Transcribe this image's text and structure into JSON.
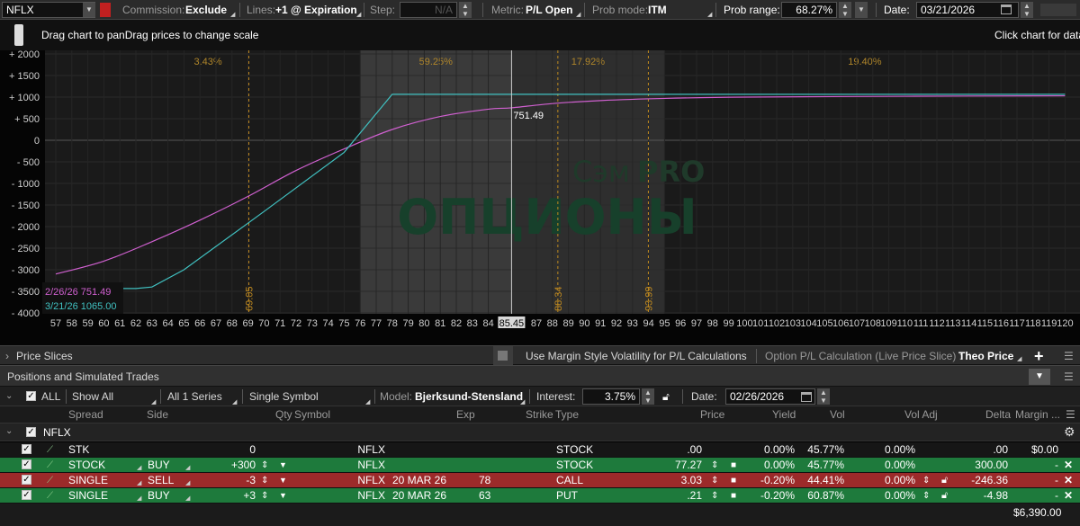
{
  "topbar": {
    "symbol": "NFLX",
    "commission_label": "Commission:",
    "commission_value": "Exclude",
    "lines_label": "Lines:",
    "lines_value": "+1 @ Expiration",
    "step_label": "Step:",
    "step_value": "N/A",
    "metric_label": "Metric:",
    "metric_value": "P/L Open",
    "prob_mode_label": "Prob mode:",
    "prob_mode_value": "ITM",
    "prob_range_label": "Prob range:",
    "prob_range_value": "68.27%",
    "date_label": "Date:",
    "date_value": "03/21/2026"
  },
  "hint": {
    "left": "Drag chart to panDrag prices to change scale",
    "right": "Click chart for data"
  },
  "watermark": {
    "line1": "Сэм",
    "line1b": "PRO",
    "line2": "ОПЦИОНЫ"
  },
  "chart_data": {
    "type": "line",
    "x": [
      57,
      58,
      59,
      60,
      61,
      62,
      63,
      64,
      65,
      66,
      67,
      68,
      69,
      70,
      71,
      72,
      73,
      74,
      75,
      76,
      77,
      78,
      79,
      80,
      81,
      82,
      83,
      84,
      85,
      86,
      87,
      88,
      89,
      90,
      91,
      92,
      93,
      94,
      95,
      96,
      97,
      98,
      99,
      100,
      101,
      102,
      103,
      104,
      105,
      106,
      107,
      108,
      109,
      110,
      111,
      112,
      113,
      114,
      115,
      116,
      117,
      118,
      119,
      120
    ],
    "x_tick_labels": [
      "57",
      "58",
      "59",
      "60",
      "61",
      "62",
      "63",
      "64",
      "65",
      "66",
      "67",
      "68",
      "69",
      "70",
      "71",
      "72",
      "73",
      "74",
      "75",
      "76",
      "77",
      "78",
      "79",
      "80",
      "81",
      "82",
      "83",
      "84",
      "85.45",
      "87",
      "88",
      "89",
      "90",
      "91",
      "92",
      "93",
      "94",
      "95",
      "96",
      "97",
      "98",
      "99",
      "100",
      "101",
      "102",
      "103",
      "104",
      "105",
      "106",
      "107",
      "108",
      "109",
      "110",
      "111",
      "112",
      "113",
      "114",
      "115",
      "116",
      "117",
      "118",
      "119",
      "120"
    ],
    "ylim": [
      -4000,
      2000
    ],
    "y_ticks": [
      "+ 2000",
      "+ 1500",
      "+ 1000",
      "+ 500",
      "0",
      "- 500",
      "- 1000",
      "- 1500",
      "- 2000",
      "- 2500",
      "- 3000",
      "- 3500",
      "- 4000"
    ],
    "series": [
      {
        "name": "2/26/26",
        "color": "#d060d0",
        "x": [
          57,
          60,
          63,
          66,
          69,
          72,
          75,
          78,
          81,
          84,
          85.45,
          88,
          91,
          95,
          100,
          110,
          120
        ],
        "y": [
          -3100,
          -2800,
          -2350,
          -1850,
          -1300,
          -700,
          -200,
          250,
          550,
          720,
          751.49,
          850,
          920,
          970,
          1000,
          1020,
          1030
        ]
      },
      {
        "name": "3/21/26",
        "color": "#40c0c0",
        "x": [
          57,
          62,
          63,
          65,
          70,
          75,
          78,
          85,
          95,
          110,
          120
        ],
        "y": [
          -3435,
          -3435,
          -3400,
          -3000,
          -1650,
          -280,
          1065,
          1065,
          1065,
          1065,
          1065
        ]
      }
    ],
    "legend": [
      {
        "text": "2/26/26 751.49",
        "color": "#d060d0"
      },
      {
        "text": "3/21/26 1065.00",
        "color": "#40c0c0"
      }
    ],
    "cursor": {
      "x": 85.45,
      "label": "751.49"
    },
    "prob_regions": [
      {
        "label": "3.43%",
        "from": 57,
        "to": 76
      },
      {
        "label": "59.25%",
        "from": 76,
        "to": 85.45
      },
      {
        "label": "17.92%",
        "from": 85.45,
        "to": 95
      },
      {
        "label": "19.40%",
        "from": 95,
        "to": 120
      }
    ],
    "vlines": [
      {
        "x": 69.05,
        "label": "69.05"
      },
      {
        "x": 88.34,
        "label": "88.34"
      },
      {
        "x": 93.99,
        "label": "93.99"
      }
    ]
  },
  "price_slices": {
    "title": "Price Slices",
    "margin_vol_label": "Use Margin Style Volatility for P/L Calculations",
    "calc_label": "Option P/L Calculation (Live Price Slice) :",
    "calc_value": "Theo Price"
  },
  "positions": {
    "title": "Positions and Simulated Trades",
    "toolbar": {
      "all": "ALL",
      "show_all": "Show All",
      "series": "All 1 Series",
      "single_symbol": "Single Symbol",
      "model_label": "Model:",
      "model_value": "Bjerksund-Stensland",
      "interest_label": "Interest:",
      "interest_value": "3.75%",
      "date_label": "Date:",
      "date_value": "02/26/2026"
    },
    "columns": [
      "Spread",
      "Side",
      "Qty",
      "Symbol",
      "Exp",
      "Strike",
      "Type",
      "Price",
      "Yield",
      "Vol",
      "Vol Adj",
      "Delta",
      "Margin ..."
    ],
    "group": "NFLX",
    "rows": [
      {
        "spread": "STK",
        "side": "",
        "qty": "0",
        "symbol": "NFLX",
        "exp": "",
        "strike": "",
        "type": "STOCK",
        "price": ".00",
        "yield": "0.00%",
        "vol": "45.77%",
        "voladj": "0.00%",
        "delta": ".00",
        "margin": "$0.00",
        "color": "#161616"
      },
      {
        "spread": "STOCK",
        "side": "BUY",
        "qty": "+300",
        "symbol": "NFLX",
        "exp": "",
        "strike": "",
        "type": "STOCK",
        "price": "77.27",
        "yield": "0.00%",
        "vol": "45.77%",
        "voladj": "0.00%",
        "delta": "300.00",
        "margin": "-",
        "color": "#1e7a3c"
      },
      {
        "spread": "SINGLE",
        "side": "SELL",
        "qty": "-3",
        "symbol": "NFLX",
        "exp": "20 MAR 26",
        "strike": "78",
        "type": "CALL",
        "price": "3.03",
        "yield": "-0.20%",
        "vol": "44.41%",
        "voladj": "0.00%",
        "delta": "-246.36",
        "margin": "-",
        "color": "#9c2a2a"
      },
      {
        "spread": "SINGLE",
        "side": "BUY",
        "qty": "+3",
        "symbol": "NFLX",
        "exp": "20 MAR 26",
        "strike": "63",
        "type": "PUT",
        "price": ".21",
        "yield": "-0.20%",
        "vol": "60.87%",
        "voladj": "0.00%",
        "delta": "-4.98",
        "margin": "-",
        "color": "#1e7a3c"
      }
    ],
    "total": "$6,390.00"
  }
}
